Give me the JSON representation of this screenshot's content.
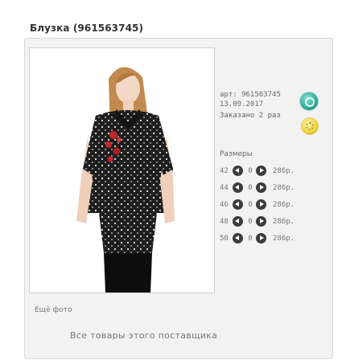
{
  "header": {
    "title": "Блузка (961563745)"
  },
  "product": {
    "article": "арт: 961563745",
    "date": "13.09.2017",
    "ordered": "Заказано 2 раз",
    "badges": [
      {
        "icon": "teal-status-icon",
        "color": "#2ea898"
      },
      {
        "icon": "yellow-status-icon",
        "color": "#f2d23a"
      }
    ]
  },
  "photo": {
    "more_label": "Ещё фото"
  },
  "sizes": {
    "title": "Размеры",
    "rows": [
      {
        "size": "42",
        "qty": "0",
        "price": "286р."
      },
      {
        "size": "44",
        "qty": "0",
        "price": "286р."
      },
      {
        "size": "46",
        "qty": "0",
        "price": "286р."
      },
      {
        "size": "48",
        "qty": "0",
        "price": "286р."
      },
      {
        "size": "50",
        "qty": "0",
        "price": "286р."
      }
    ]
  },
  "footer": {
    "all_supplier_goods": "Все товары этого поставщика"
  }
}
